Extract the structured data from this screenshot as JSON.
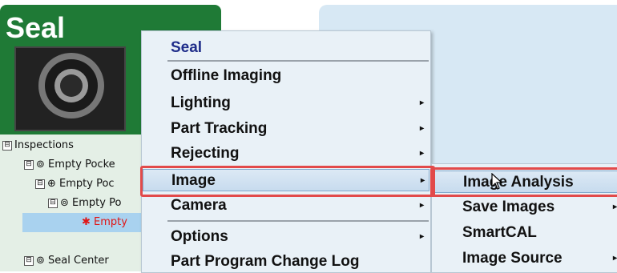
{
  "left_panel": {
    "title": "Seal",
    "tree": [
      {
        "toggle": "⊟",
        "label": "Inspections"
      },
      {
        "toggle": "⊟",
        "icon": "⊚",
        "label": "Empty Pocke"
      },
      {
        "toggle": "⊟",
        "icon": "⊕",
        "label": "Empty Poc"
      },
      {
        "toggle": "⊟",
        "icon": "⊚",
        "label": "Empty Po"
      },
      {
        "icon": "✱",
        "label": "Empty"
      },
      {
        "toggle": "⊟",
        "icon": "⊚",
        "label": "Seal Center"
      }
    ]
  },
  "context_menu": {
    "header": "Seal",
    "items": [
      {
        "label": "Offline Imaging",
        "submenu_arrow": ""
      },
      {
        "label": "Lighting",
        "submenu_arrow": "▸"
      },
      {
        "label": "Part Tracking",
        "submenu_arrow": "▸"
      },
      {
        "label": "Rejecting",
        "submenu_arrow": "▸"
      },
      {
        "label": "Image",
        "submenu_arrow": "▸"
      },
      {
        "label": "Camera",
        "submenu_arrow": "▸"
      },
      {
        "label": "Options",
        "submenu_arrow": "▸"
      },
      {
        "label": "Part Program Change Log",
        "submenu_arrow": ""
      }
    ],
    "highlighted_item": "Image"
  },
  "submenu": {
    "items": [
      {
        "label": "Image Analysis",
        "submenu_arrow": ""
      },
      {
        "label": "Save Images",
        "submenu_arrow": "▸"
      },
      {
        "label": "SmartCAL",
        "submenu_arrow": ""
      },
      {
        "label": "Image Source",
        "submenu_arrow": "▸"
      }
    ],
    "highlighted_item": "Image Analysis"
  },
  "colors": {
    "panel_green": "#1f7a36",
    "menu_bg": "#e9f1f7",
    "header_blue": "#1f2d8a",
    "highlight_outline": "#e24a4a",
    "right_area": "#d7e8f4"
  },
  "icons": [
    "collapse-icon",
    "inspection-icon",
    "add-icon",
    "star-icon",
    "submenu-arrow-icon",
    "mouse-cursor-icon"
  ]
}
